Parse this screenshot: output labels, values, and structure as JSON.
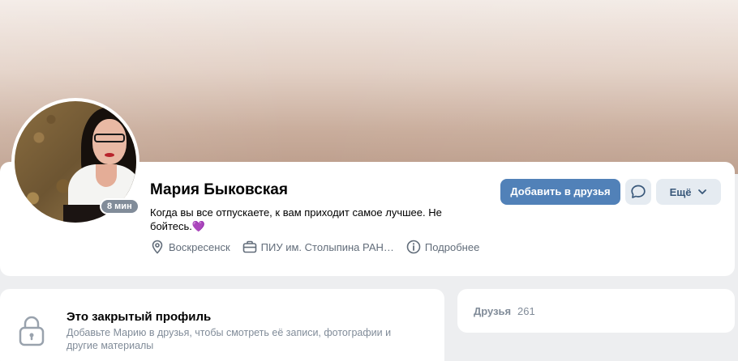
{
  "profile": {
    "name": "Мария Быковская",
    "status": "Когда вы все отпускаете, к вам приходит самое лучшее. Не бойтесь.",
    "status_emoji": "💜",
    "online": "8 мин",
    "city": "Воскресенск",
    "education": "ПИУ им. Столыпина РАН…",
    "more_info": "Подробнее"
  },
  "actions": {
    "add_friend": "Добавить в друзья",
    "more": "Ещё"
  },
  "closed": {
    "title": "Это закрытый профиль",
    "description": "Добавьте Марию в друзья, чтобы смотреть её записи, фотографии и другие материалы"
  },
  "friends": {
    "label": "Друзья",
    "count": "261"
  },
  "colors": {
    "accent": "#5181b8",
    "secondary_button": "#e5ebf1",
    "muted_text": "#818c99",
    "icon": "#626d7a"
  },
  "icons": [
    "location-icon",
    "briefcase-icon",
    "info-icon",
    "message-icon",
    "chevron-down-icon",
    "lock-icon"
  ]
}
